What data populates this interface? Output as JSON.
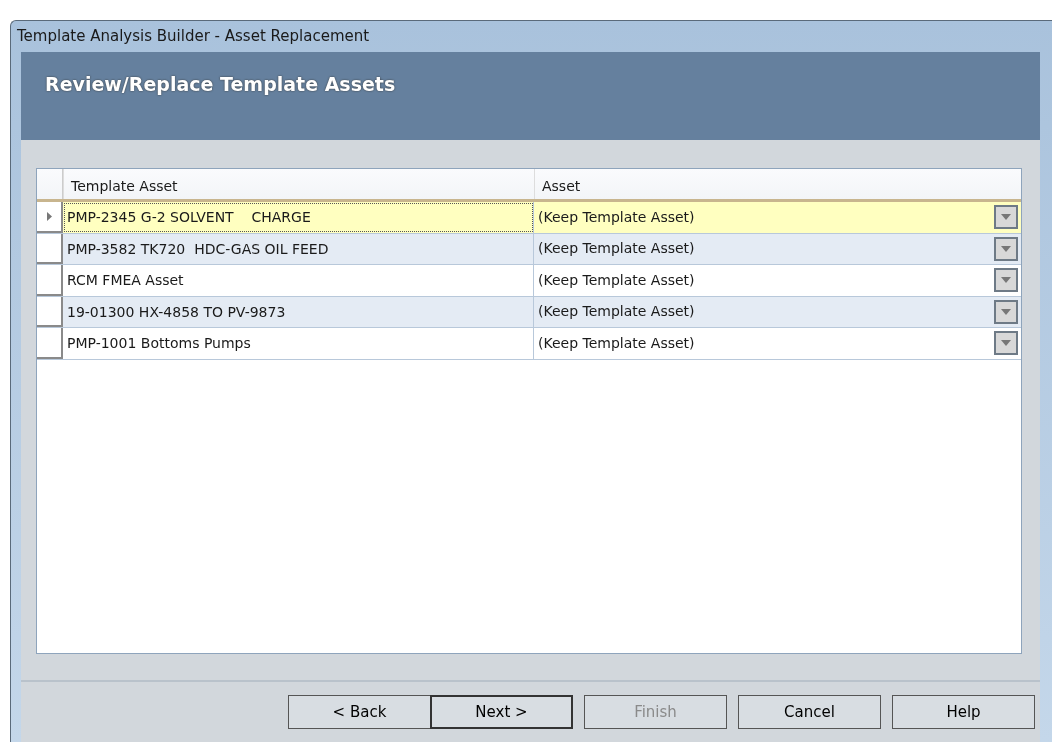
{
  "window": {
    "title": "Template Analysis Builder - Asset Replacement"
  },
  "header": {
    "title": "Review/Replace Template Assets"
  },
  "table": {
    "columns": [
      "Template Asset",
      "Asset"
    ],
    "rows": [
      {
        "template_asset": "PMP-2345 G-2 SOLVENT    CHARGE",
        "asset": "(Keep Template Asset)",
        "selected": true
      },
      {
        "template_asset": "PMP-3582 TK720  HDC-GAS OIL FEED",
        "asset": "(Keep Template Asset)",
        "selected": false
      },
      {
        "template_asset": "RCM FMEA Asset",
        "asset": "(Keep Template Asset)",
        "selected": false
      },
      {
        "template_asset": "19-01300 HX-4858 TO PV-9873",
        "asset": "(Keep Template Asset)",
        "selected": false
      },
      {
        "template_asset": "PMP-1001 Bottoms Pumps",
        "asset": "(Keep Template Asset)",
        "selected": false
      }
    ]
  },
  "buttons": [
    {
      "label": "< Back",
      "disabled": false,
      "default": false
    },
    {
      "label": "Next >",
      "disabled": false,
      "default": true
    },
    {
      "label": "Finish",
      "disabled": true,
      "default": false
    },
    {
      "label": "Cancel",
      "disabled": false,
      "default": false
    },
    {
      "label": "Help",
      "disabled": false,
      "default": false
    }
  ]
}
